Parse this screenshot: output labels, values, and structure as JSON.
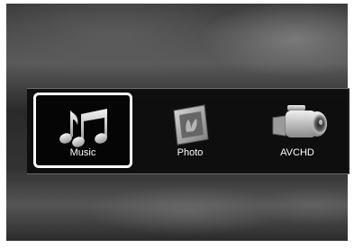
{
  "menu": {
    "selected_index": 0,
    "items": [
      {
        "label": "Music",
        "icon": "music-notes-icon"
      },
      {
        "label": "Photo",
        "icon": "photo-frame-icon"
      },
      {
        "label": "AVCHD",
        "icon": "camcorder-icon"
      }
    ]
  },
  "colors": {
    "selection_border": "#ffffff",
    "label_text": "#ffffff",
    "menu_bar": "#0c0c0c"
  }
}
